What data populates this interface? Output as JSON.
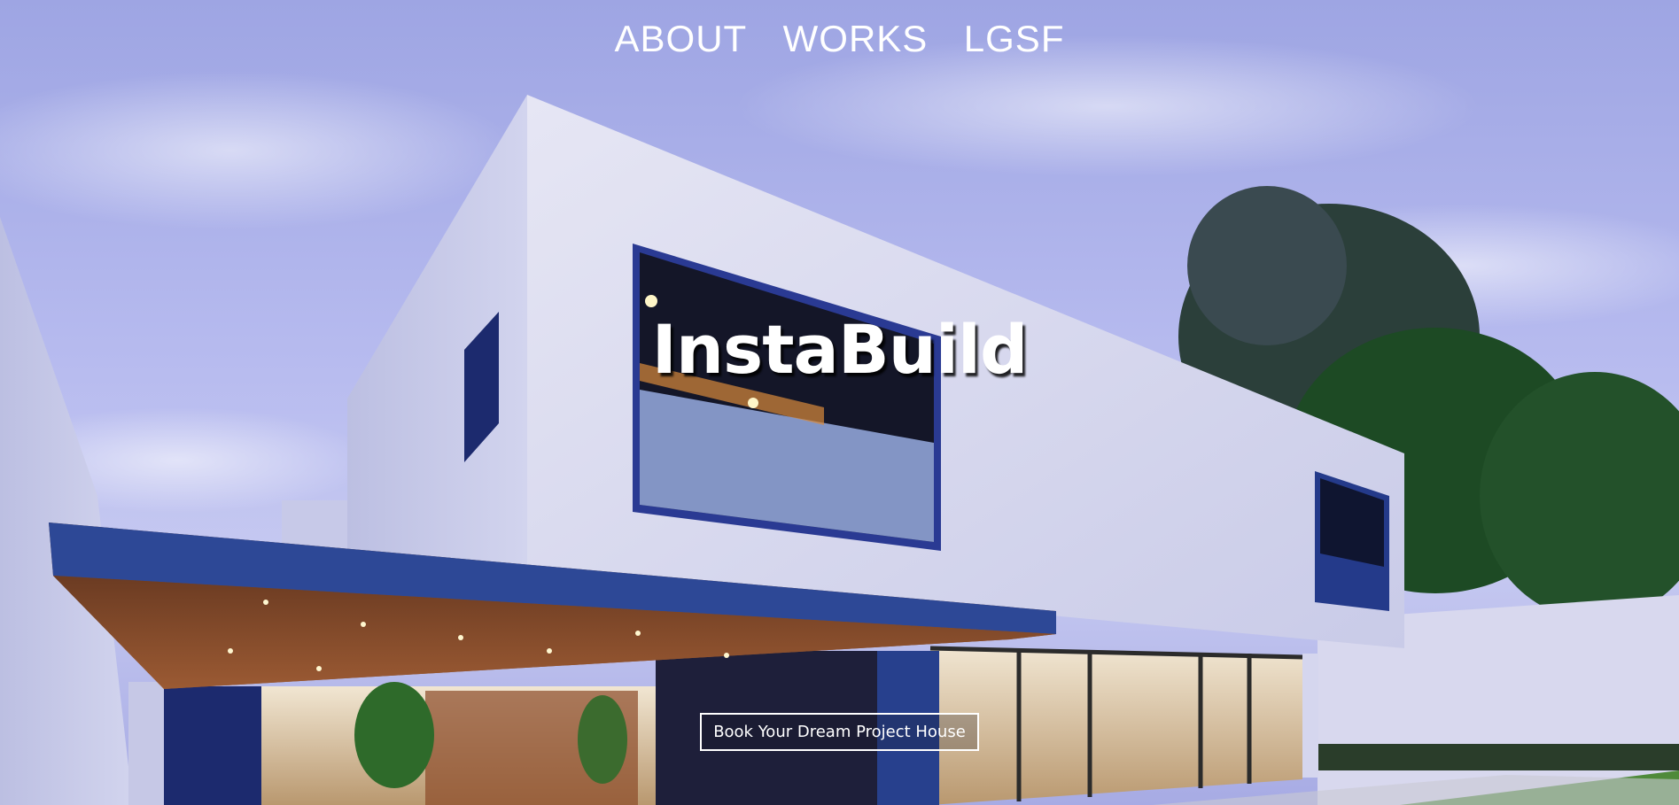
{
  "nav": {
    "items": [
      {
        "label": "ABOUT"
      },
      {
        "label": "WORKS"
      },
      {
        "label": "LGSF"
      }
    ]
  },
  "hero": {
    "brand": "InstaBuild",
    "cta_label": "Book Your Dream Project House",
    "background_image": "modern-two-storey-house-at-dusk"
  },
  "colors": {
    "text": "#ffffff",
    "sky": "#aab0ea",
    "wall": "#d9dcef",
    "canopy": "#2f4a9a"
  }
}
